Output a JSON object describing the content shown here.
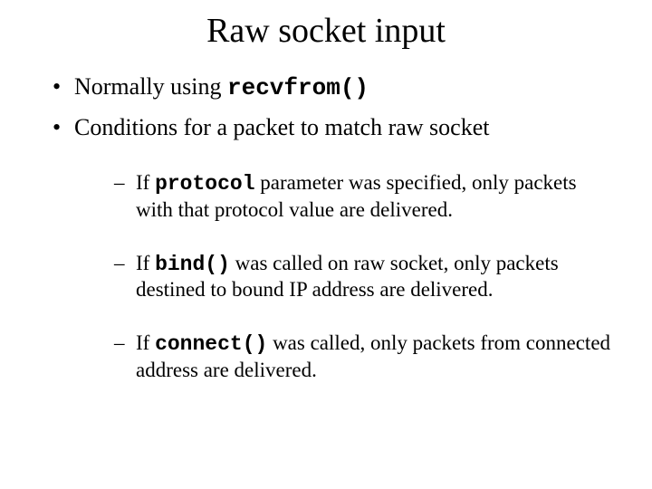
{
  "title": "Raw socket input",
  "b1_a": "Normally using ",
  "b1_code": "recvfrom()",
  "b2": "Conditions for a packet to match raw socket",
  "s1_a": "If ",
  "s1_code": "protocol",
  "s1_b": " parameter was specified, only packets with that protocol value are delivered.",
  "s2_a": "If ",
  "s2_code": "bind()",
  "s2_b": " was called on raw socket, only packets destined to bound IP address are delivered.",
  "s3_a": "If ",
  "s3_code": "connect()",
  "s3_b": " was called, only packets from connected address are delivered."
}
